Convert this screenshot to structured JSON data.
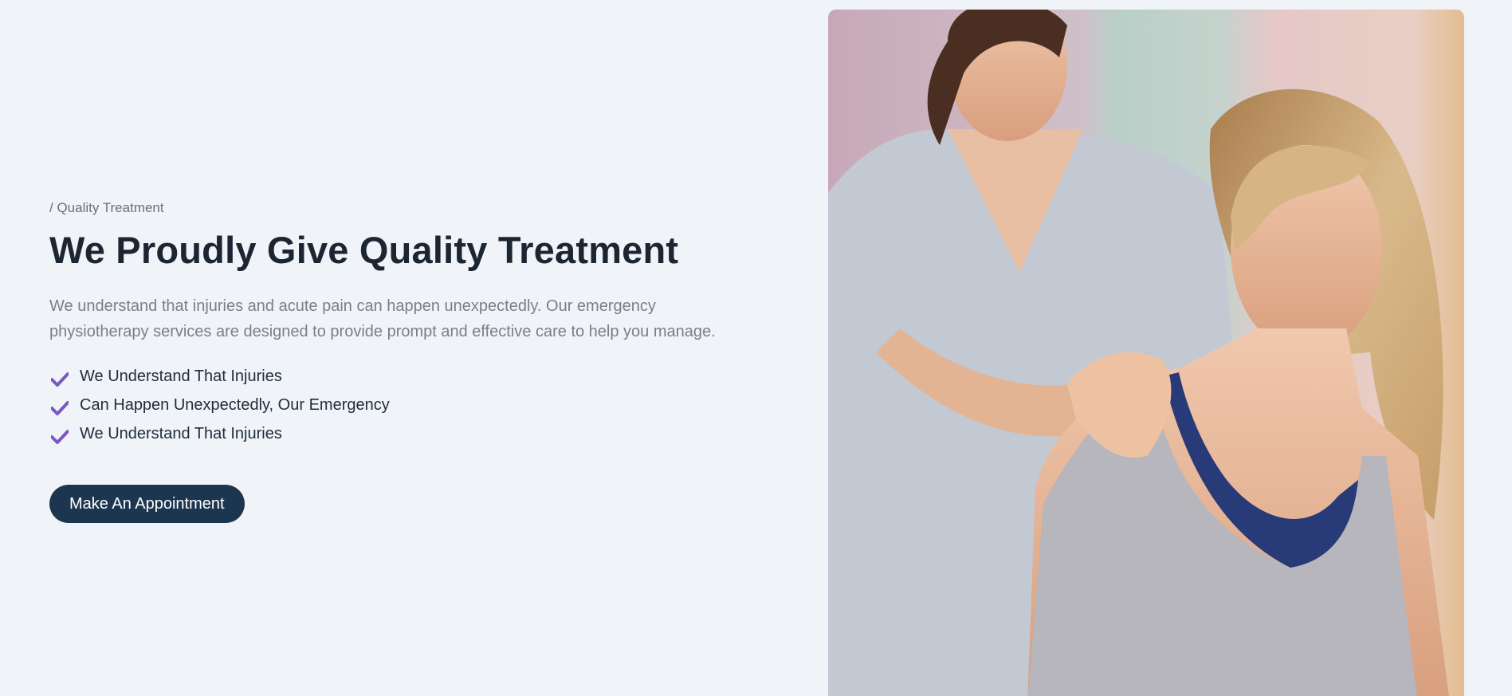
{
  "section": {
    "eyebrow": "/ Quality Treatment",
    "title": "We Proudly Give Quality Treatment",
    "description": "We understand that injuries and acute pain can happen unexpectedly. Our emergency physiotherapy services are designed to provide prompt and effective care to help you manage.",
    "features": [
      {
        "label": "We Understand That Injuries",
        "icon": "check-icon"
      },
      {
        "label": "Can Happen Unexpectedly, Our Emergency",
        "icon": "check-icon"
      },
      {
        "label": "We Understand That Injuries",
        "icon": "check-icon"
      }
    ],
    "cta_label": "Make An Appointment"
  },
  "colors": {
    "accent_check": "#7b57c2",
    "button_bg": "#1c3650",
    "page_bg": "#f0f3f8",
    "heading": "#1b2632"
  }
}
